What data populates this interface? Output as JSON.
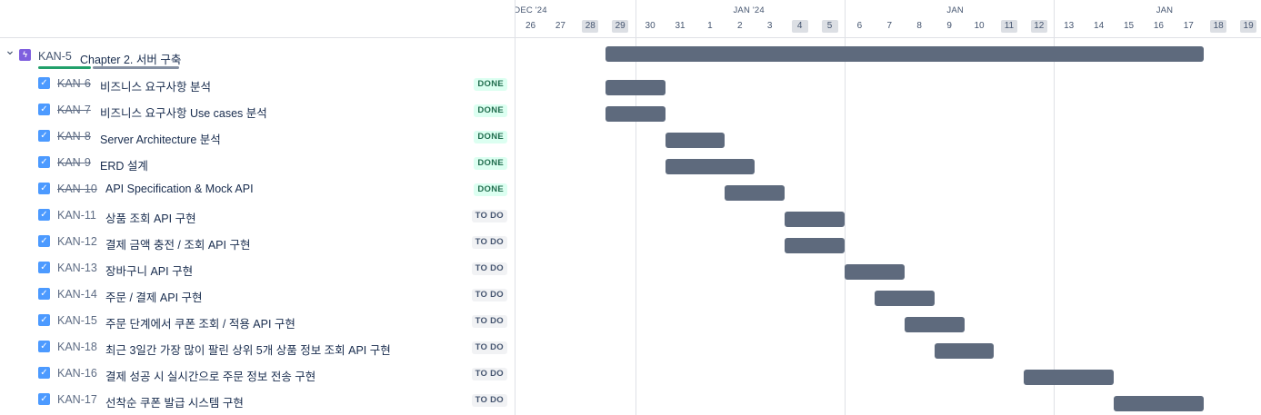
{
  "timeline": {
    "months": [
      {
        "label": "DEC '24",
        "col": 0
      },
      {
        "label": "JAN '24",
        "col": 7.3
      },
      {
        "label": "JAN",
        "col": 14.2
      },
      {
        "label": "JAN",
        "col": 21.2
      }
    ],
    "days": [
      {
        "label": "26",
        "weekend": false
      },
      {
        "label": "27",
        "weekend": false
      },
      {
        "label": "28",
        "weekend": true
      },
      {
        "label": "29",
        "weekend": true
      },
      {
        "label": "30",
        "weekend": false
      },
      {
        "label": "31",
        "weekend": false
      },
      {
        "label": "1",
        "weekend": false
      },
      {
        "label": "2",
        "weekend": false
      },
      {
        "label": "3",
        "weekend": false
      },
      {
        "label": "4",
        "weekend": true
      },
      {
        "label": "5",
        "weekend": true
      },
      {
        "label": "6",
        "weekend": false
      },
      {
        "label": "7",
        "weekend": false
      },
      {
        "label": "8",
        "weekend": false
      },
      {
        "label": "9",
        "weekend": false
      },
      {
        "label": "10",
        "weekend": false
      },
      {
        "label": "11",
        "weekend": true
      },
      {
        "label": "12",
        "weekend": true
      },
      {
        "label": "13",
        "weekend": false
      },
      {
        "label": "14",
        "weekend": false
      },
      {
        "label": "15",
        "weekend": false
      },
      {
        "label": "16",
        "weekend": false
      },
      {
        "label": "17",
        "weekend": false
      },
      {
        "label": "18",
        "weekend": true
      },
      {
        "label": "19",
        "weekend": true
      }
    ],
    "week_separators": [
      4,
      11,
      18
    ]
  },
  "epic": {
    "key": "KAN-5",
    "summary": "Chapter 2. 서버 구축",
    "icon": "lightning-icon",
    "start": 3,
    "end": 23,
    "progress": {
      "done": 5,
      "total": 13
    }
  },
  "issues": [
    {
      "key": "KAN-6",
      "summary": "비즈니스 요구사항 분석",
      "status": "DONE",
      "done": true,
      "start": 3,
      "end": 5
    },
    {
      "key": "KAN-7",
      "summary": "비즈니스 요구사항 Use cases 분석",
      "status": "DONE",
      "done": true,
      "start": 3,
      "end": 5
    },
    {
      "key": "KAN-8",
      "summary": "Server Architecture 분석",
      "status": "DONE",
      "done": true,
      "start": 5,
      "end": 7
    },
    {
      "key": "KAN-9",
      "summary": "ERD 설계",
      "status": "DONE",
      "done": true,
      "start": 5,
      "end": 8
    },
    {
      "key": "KAN-10",
      "summary": "API Specification & Mock API",
      "status": "DONE",
      "done": true,
      "start": 7,
      "end": 9
    },
    {
      "key": "KAN-11",
      "summary": "상품 조회 API 구현",
      "status": "TO DO",
      "done": false,
      "start": 9,
      "end": 11
    },
    {
      "key": "KAN-12",
      "summary": "결제 금액 충전 / 조회 API 구현",
      "status": "TO DO",
      "done": false,
      "start": 9,
      "end": 11
    },
    {
      "key": "KAN-13",
      "summary": "장바구니 API 구현",
      "status": "TO DO",
      "done": false,
      "start": 11,
      "end": 13
    },
    {
      "key": "KAN-14",
      "summary": "주문 / 결제 API 구현",
      "status": "TO DO",
      "done": false,
      "start": 12,
      "end": 14
    },
    {
      "key": "KAN-15",
      "summary": "주문 단계에서 쿠폰 조회 / 적용 API 구현",
      "status": "TO DO",
      "done": false,
      "start": 13,
      "end": 15
    },
    {
      "key": "KAN-18",
      "summary": "최근 3일간 가장 많이 팔린 상위 5개 상품 정보 조회 API 구현",
      "status": "TO DO",
      "done": false,
      "start": 14,
      "end": 16
    },
    {
      "key": "KAN-16",
      "summary": "결제 성공 시 실시간으로 주문 정보 전송 구현",
      "status": "TO DO",
      "done": false,
      "start": 17,
      "end": 20
    },
    {
      "key": "KAN-17",
      "summary": "선착순 쿠폰 발급 시스템 구현",
      "status": "TO DO",
      "done": false,
      "start": 20,
      "end": 23
    }
  ],
  "colors": {
    "bar": "#5e6a7d",
    "done_progress": "#22a06b",
    "todo_progress": "#8590a2",
    "epic_icon": "#7f5fde",
    "task_icon": "#4c9aff"
  }
}
